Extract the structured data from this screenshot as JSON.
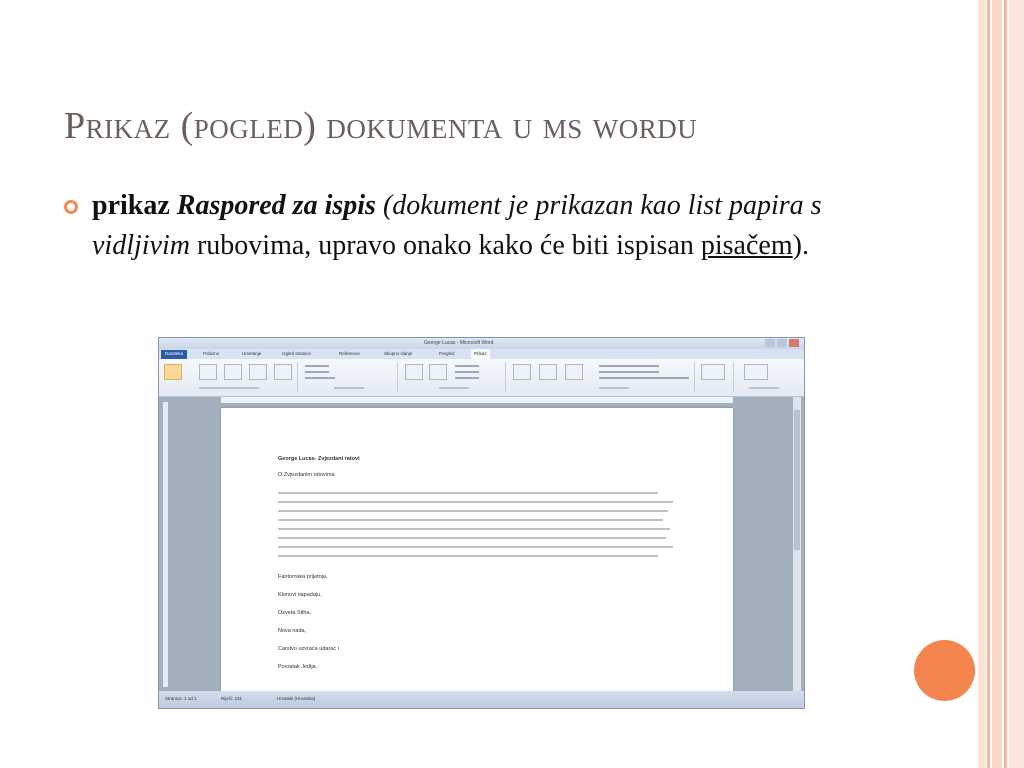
{
  "slide": {
    "title": "Prikaz (pogled) dokumenta u ms wordu",
    "bullet": {
      "lead": "prikaz ",
      "term": "Raspored za ispis",
      "space_after_term": " ",
      "paren_open_italic": "(dokument je prikazan kao list papira s vidljivim",
      "tail_1": " rubovima, upravo onako kako će biti ispisan ",
      "link": "pisačem",
      "tail_2": ")."
    }
  },
  "colors": {
    "accent_orange": "#f5854f",
    "title_gray": "#6b5f5a",
    "stripe_pink": "#f8c5b0"
  },
  "word_screenshot": {
    "window_title": "George Lucas - Microsoft Word",
    "tabs": [
      "Datoteka",
      "Polazno",
      "Umetanje",
      "Izgled stranice",
      "Reference",
      "Skupno slanje",
      "Pregled",
      "Prikaz"
    ],
    "active_tab": "Prikaz",
    "document_heading": "George Lucas- Zvjezdani ratovi",
    "document_lines": [
      "O Zvjezdanim ratovima",
      "Fantomska prijetnja,",
      "Klonovi napadaju,",
      "Osveta Sitha,",
      "Nova nada,",
      "Carstvo uzvraća udarac i",
      "Povratak Jedija."
    ],
    "status_items": [
      "Stranica: 1 od 1",
      "Riječi: 231",
      "Hrvatski (Hrvatska)"
    ]
  }
}
